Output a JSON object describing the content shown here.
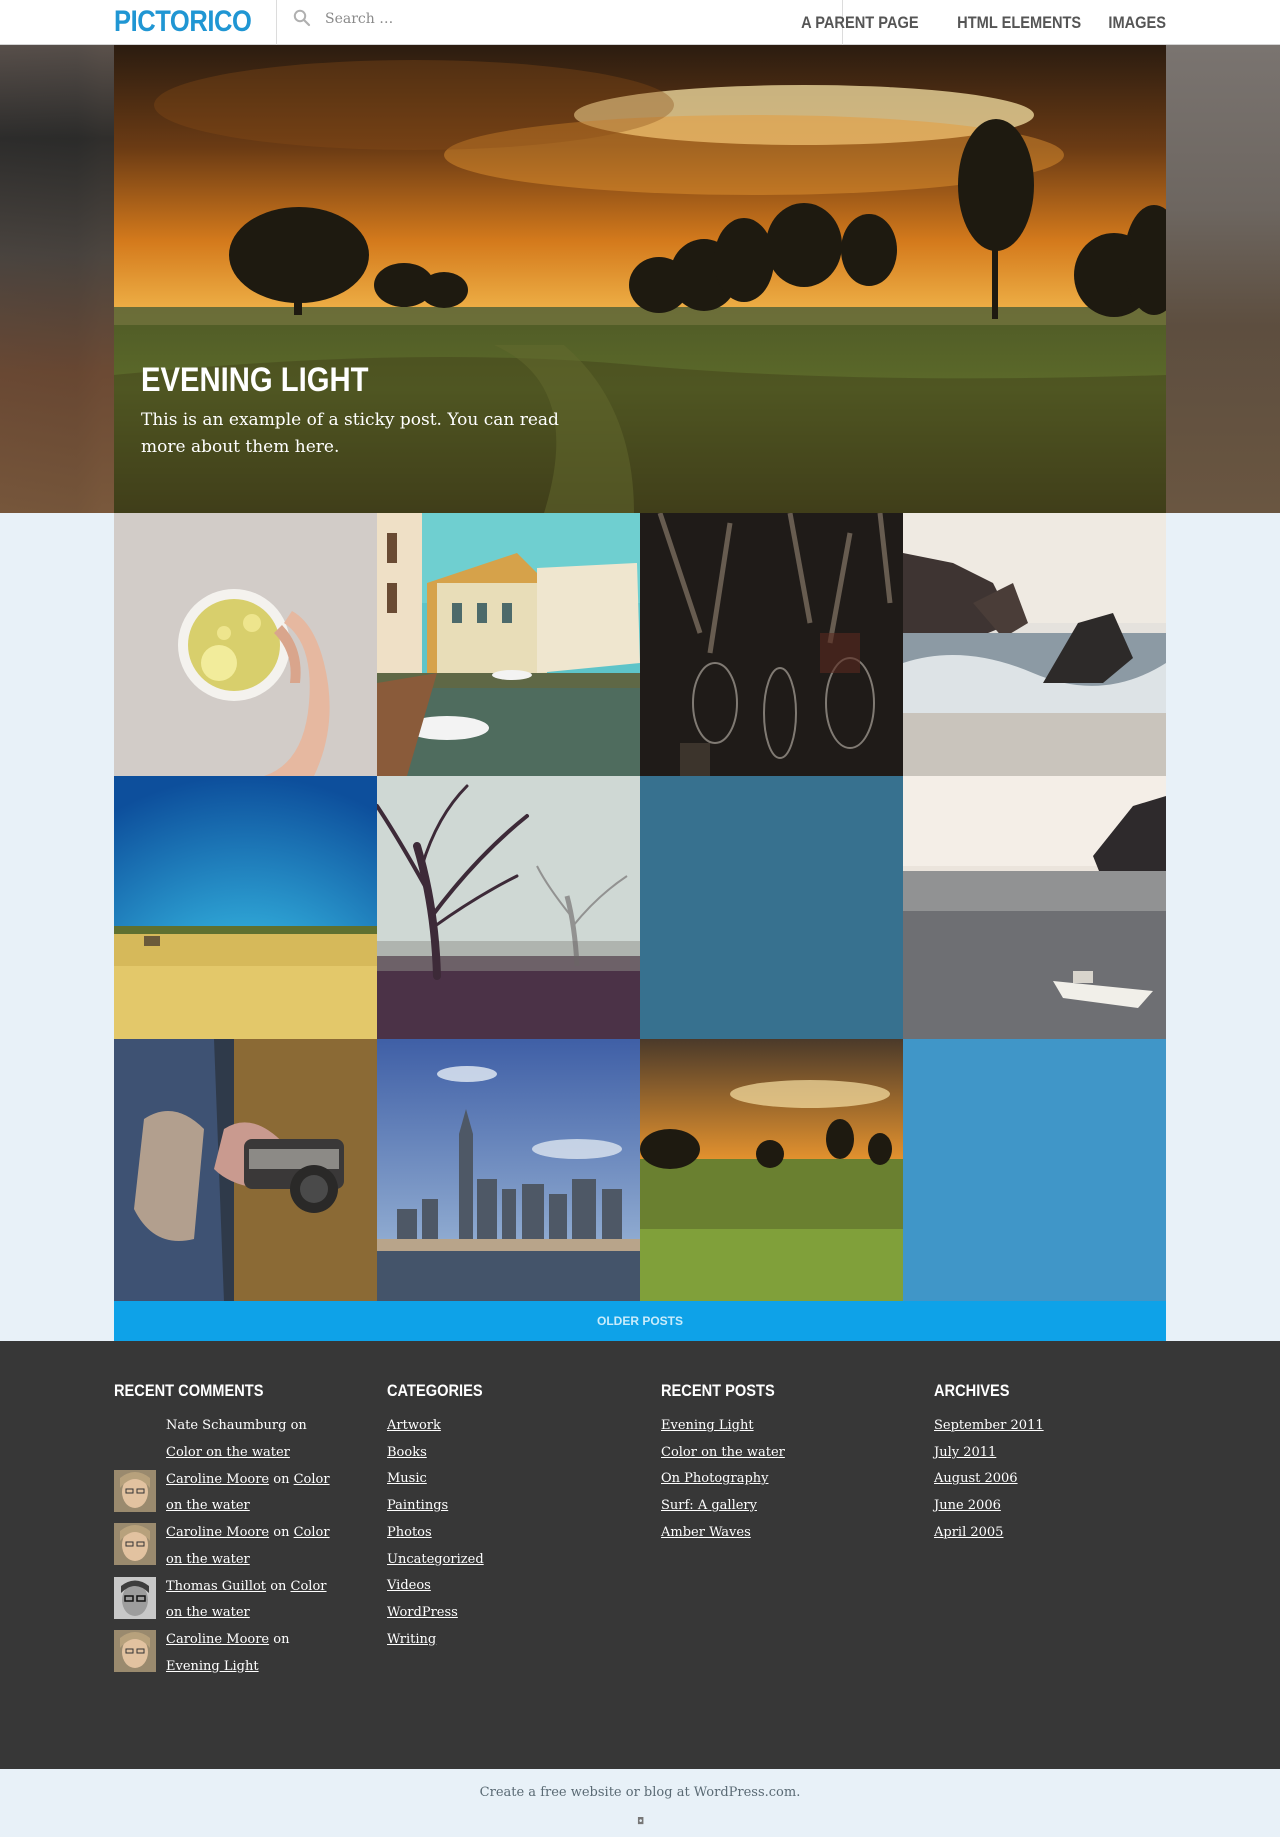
{
  "site": {
    "title": "PICTORICO"
  },
  "search": {
    "placeholder": "Search …"
  },
  "nav": {
    "items": [
      {
        "label": "A PARENT PAGE"
      },
      {
        "label": "HTML ELEMENTS"
      },
      {
        "label": "IMAGES"
      }
    ]
  },
  "hero": {
    "title": "EVENING LIGHT",
    "excerpt": "This is an example of a sticky post. You can read more about them here."
  },
  "tiles": [
    {
      "subject": "tea-cup-photo"
    },
    {
      "subject": "canal-town-photo"
    },
    {
      "subject": "tools-photo"
    },
    {
      "subject": "rocky-shore-photo"
    },
    {
      "subject": "wheat-field-photo"
    },
    {
      "subject": "foggy-trees-photo"
    },
    {
      "subject": "placeholder-tile",
      "color": "#37718f"
    },
    {
      "subject": "boat-bay-photo"
    },
    {
      "subject": "camera-hands-photo"
    },
    {
      "subject": "city-skyline-photo"
    },
    {
      "subject": "evening-field-photo"
    },
    {
      "subject": "placeholder-tile",
      "color": "#4096c8"
    }
  ],
  "older_posts": {
    "label": "OLDER POSTS"
  },
  "footer": {
    "recent_comments": {
      "title": "RECENT COMMENTS",
      "items": [
        {
          "author": "Nate Schaumburg",
          "on": "on",
          "post": "Color on the water"
        },
        {
          "author": "Caroline Moore",
          "on": "on",
          "post": "Color on the water"
        },
        {
          "author": "Caroline Moore",
          "on": "on",
          "post": "Color on the water"
        },
        {
          "author": "Thomas Guillot",
          "on": "on",
          "post": "Color on the water"
        },
        {
          "author": "Caroline Moore",
          "on": "on",
          "post": "Evening Light"
        }
      ]
    },
    "categories": {
      "title": "CATEGORIES",
      "items": [
        "Artwork",
        "Books",
        "Music",
        "Paintings",
        "Photos",
        "Uncategorized",
        "Videos",
        "WordPress",
        "Writing"
      ]
    },
    "recent_posts": {
      "title": "RECENT POSTS",
      "items": [
        "Evening Light",
        "Color on the water",
        "On Photography",
        "Surf: A gallery",
        "Amber Waves"
      ]
    },
    "archives": {
      "title": "ARCHIVES",
      "items": [
        "September 2011",
        "July 2011",
        "August 2006",
        "June 2006",
        "April 2005"
      ]
    }
  },
  "site_info": {
    "credit": "Create a free website or blog at WordPress.com."
  },
  "colors": {
    "accent": "#2096d3",
    "button": "#0ea2e8",
    "footer_bg": "#373737",
    "page_bg": "#e8f1f8"
  }
}
